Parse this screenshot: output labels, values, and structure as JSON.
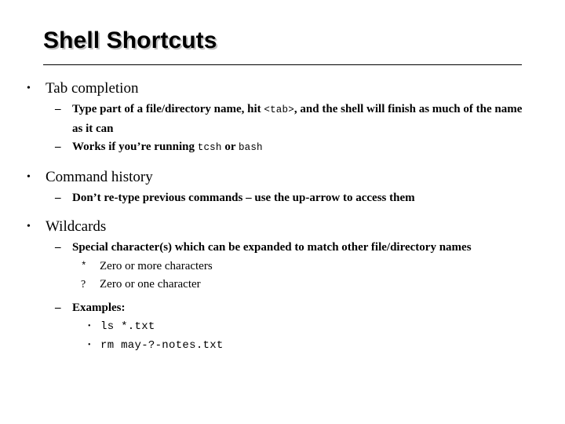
{
  "slide": {
    "title": "Shell Shortcuts",
    "background_color": "#ffffff",
    "text_color": "#000000",
    "title_shadow_color": "#bfbfbf",
    "bullets": {
      "level1_marker": "•",
      "level2_marker": "–",
      "level4_marker": "•",
      "star_marker": "*",
      "question_marker": "?"
    },
    "sections": [
      {
        "heading": "Tab completion",
        "items": [
          {
            "prefix": "Type part of a file/directory name, hit ",
            "code": "<tab>",
            "suffix": ", and the shell will finish as much of the name as it can"
          },
          {
            "prefix": "Works if you’re running ",
            "code": "tcsh",
            "middle": " or ",
            "code2": "bash",
            "suffix": ""
          }
        ]
      },
      {
        "heading": "Command history",
        "items": [
          {
            "text": "Don’t re-type previous commands – use the up-arrow to access them"
          }
        ]
      },
      {
        "heading": "Wildcards",
        "items": [
          {
            "text": "Special character(s) which can be expanded to match other file/directory names",
            "subitems": [
              {
                "marker": "*",
                "text": "Zero or more characters"
              },
              {
                "marker": "?",
                "text": "Zero or one character"
              }
            ]
          },
          {
            "text": "Examples:",
            "examples": [
              "ls *.txt",
              "rm may-?-notes.txt"
            ]
          }
        ]
      }
    ]
  }
}
